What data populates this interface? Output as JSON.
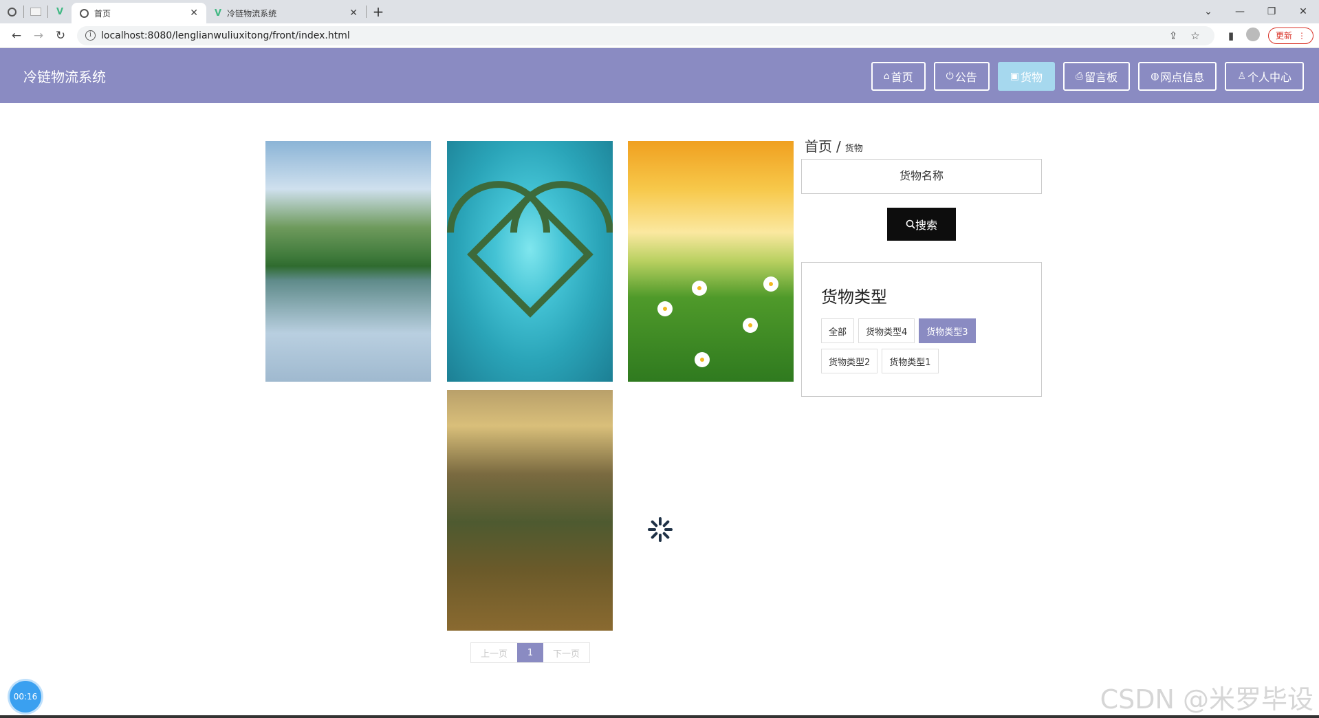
{
  "browser": {
    "tabs": [
      {
        "title": "首页",
        "active": true
      },
      {
        "title": "冷链物流系统",
        "active": false
      }
    ],
    "url": "localhost:8080/lenglianwuliuxitong/front/index.html",
    "update_label": "更新"
  },
  "site": {
    "title": "冷链物流系统",
    "nav": [
      {
        "label": "首页",
        "icon": "home-icon",
        "active": false
      },
      {
        "label": "公告",
        "icon": "power-icon",
        "active": false
      },
      {
        "label": "货物",
        "icon": "image-icon",
        "active": true
      },
      {
        "label": "留言板",
        "icon": "printer-icon",
        "active": false
      },
      {
        "label": "网点信息",
        "icon": "globe-icon",
        "active": false
      },
      {
        "label": "个人中心",
        "icon": "user-icon",
        "active": false
      }
    ]
  },
  "breadcrumb": {
    "home": "首页",
    "separator": "/",
    "current": "货物"
  },
  "search": {
    "placeholder": "货物名称",
    "button_label": "搜索"
  },
  "types": {
    "title": "货物类型",
    "items": [
      {
        "label": "全部",
        "active": false
      },
      {
        "label": "货物类型4",
        "active": false
      },
      {
        "label": "货物类型3",
        "active": true
      },
      {
        "label": "货物类型2",
        "active": false
      },
      {
        "label": "货物类型1",
        "active": false
      }
    ]
  },
  "goods": [
    {
      "image": "mountain-lake"
    },
    {
      "image": "heart-island"
    },
    {
      "image": "daisy-field"
    },
    {
      "image": "mountain-valley"
    }
  ],
  "pagination": {
    "prev_label": "上一页",
    "current_page": "1",
    "next_label": "下一页"
  },
  "timer": "00:16",
  "watermark": "CSDN @米罗毕设",
  "colors": {
    "header": "#8a8bc2",
    "active_nav": "#a6d8ee",
    "search_button": "#0d0d0d"
  }
}
